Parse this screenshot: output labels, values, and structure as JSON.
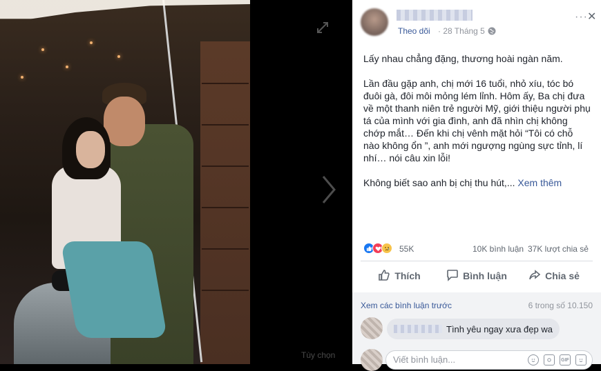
{
  "viewer": {
    "options_label": "Tùy chọn"
  },
  "post": {
    "author": "",
    "follow_label": "Theo dõi",
    "date": "28 Tháng 5",
    "paragraphs": [
      "Lấy nhau chẳng đặng, thương hoài ngàn năm.",
      "Lần đầu gặp anh, chị mới 16 tuổi, nhỏ xíu, tóc bó đuôi gà, đôi môi mỏng lém lỉnh. Hôm ấy, Ba chị đưa về một thanh niên trẻ người Mỹ, giới thiệu người phụ tá của mình với gia đình, anh đã nhìn chị không chớp mắt… Đến khi chị vênh mặt hỏi “Tôi có chỗ nào không ổn ”, anh mới ngượng ngùng sực tỉnh, lí nhí… nói câu xin lỗi!",
      "Không biết sao anh bị chị thu hút,..."
    ],
    "see_more": "Xem thêm"
  },
  "stats": {
    "reaction_count": "55K",
    "comments": "10K bình luận",
    "shares": "37K lượt chia sẻ",
    "reactions": [
      "like",
      "love",
      "sad"
    ]
  },
  "actions": {
    "like": "Thích",
    "comment": "Bình luận",
    "share": "Chia sẻ"
  },
  "comments": {
    "view_previous": "Xem các bình luận trước",
    "count": "6 trong số 10.150",
    "items": [
      {
        "author": "",
        "text": "Tình yêu ngay xưa đẹp wa"
      }
    ],
    "input_placeholder": "Viết bình luận..."
  },
  "colors": {
    "link": "#385898",
    "like": "#1877f2",
    "love": "#f33e58",
    "sad": "#f7c34a"
  }
}
